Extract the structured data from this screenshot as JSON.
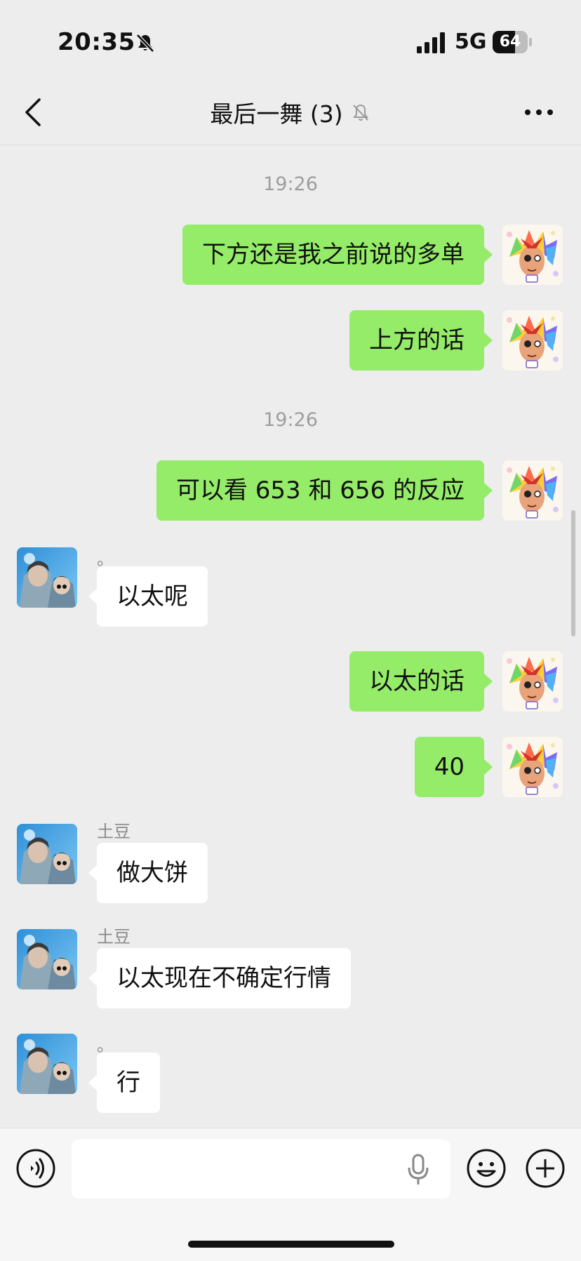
{
  "status_bar": {
    "time": "20:35",
    "network": "5G",
    "battery": "64",
    "battery_level": 0.64
  },
  "nav": {
    "title": "最后一舞 (3)"
  },
  "messages": [
    {
      "kind": "time",
      "text": "19:26"
    },
    {
      "kind": "me",
      "text": "下方还是我之前说的多单"
    },
    {
      "kind": "me",
      "text": "上方的话"
    },
    {
      "kind": "time",
      "text": "19:26"
    },
    {
      "kind": "me",
      "text": "可以看 653 和 656 的反应"
    },
    {
      "kind": "other",
      "sender": "。",
      "text": "以太呢"
    },
    {
      "kind": "me",
      "text": "以太的话"
    },
    {
      "kind": "me",
      "text": "40"
    },
    {
      "kind": "other",
      "sender": "土豆",
      "text": "做大饼"
    },
    {
      "kind": "other",
      "sender": "土豆",
      "text": "以太现在不确定行情"
    },
    {
      "kind": "other",
      "sender": "。",
      "text": "行"
    }
  ],
  "input": {
    "value": "",
    "placeholder": ""
  },
  "icons": {
    "back": "chevron-left-icon",
    "mute": "bell-slash-icon",
    "more": "more-dots-icon",
    "voice": "voice-mode-icon",
    "mic": "microphone-icon",
    "emoji": "emoji-icon",
    "plus": "plus-icon"
  },
  "colors": {
    "background": "#ededed",
    "my_bubble": "#95ec69",
    "other_bubble": "#ffffff"
  }
}
